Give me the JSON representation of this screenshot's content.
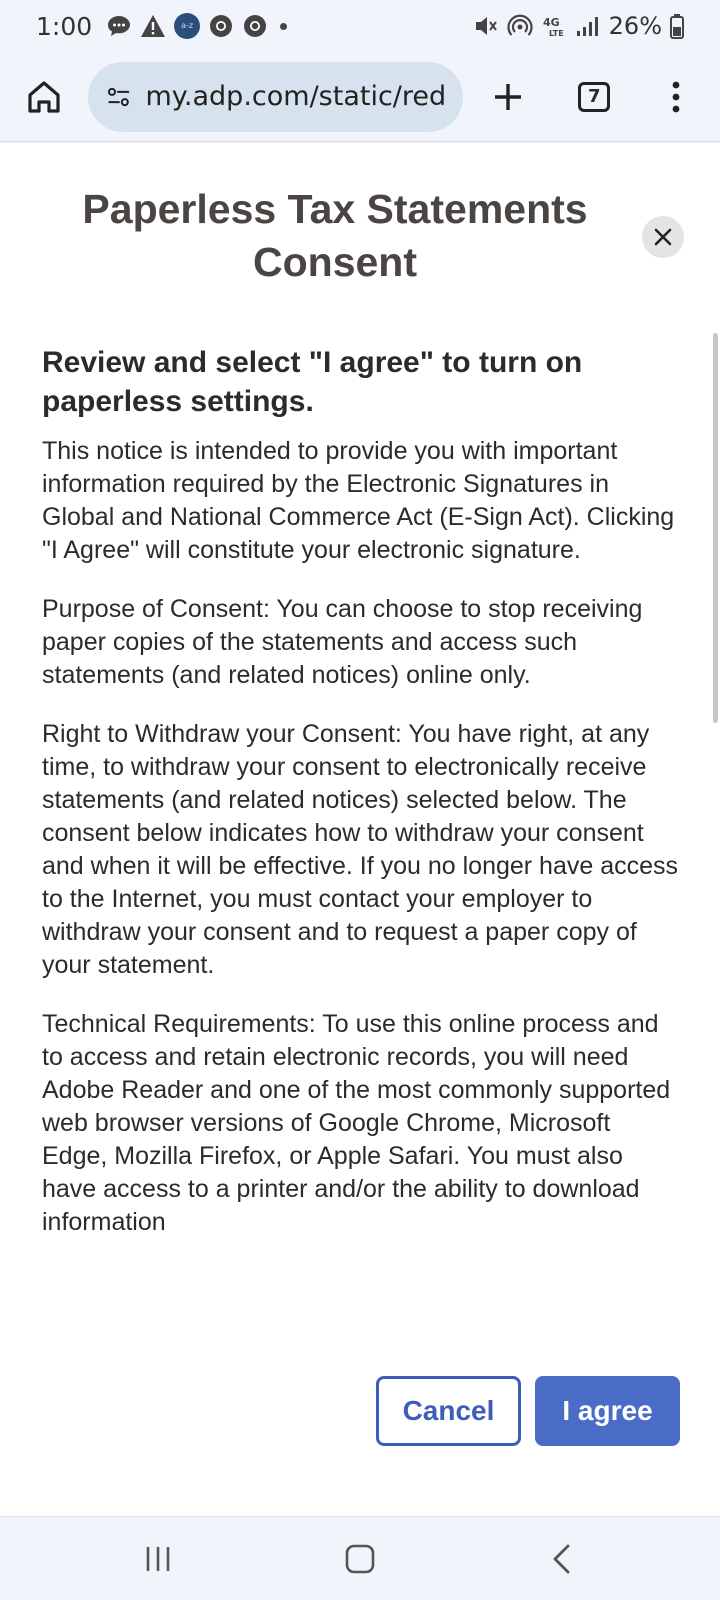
{
  "status_bar": {
    "time": "1:00",
    "battery": "26%",
    "icons": [
      "message-icon",
      "warning-icon",
      "amazon-a-to-z-icon",
      "chrome-icon",
      "chrome-icon",
      "dot-icon",
      "mute-icon",
      "hotspot-icon",
      "4g-lte-icon",
      "signal-icon",
      "battery-icon"
    ],
    "amazon_label": "a-z"
  },
  "browser": {
    "url": "my.adp.com/static/redbox",
    "tab_count": "7"
  },
  "modal": {
    "title": "Paperless Tax Statements Consent",
    "heading": "Review and select \"I agree\" to turn on paperless settings.",
    "paragraphs": [
      "This notice is intended to provide you with important information required by the Electronic Signatures in Global and National Commerce Act (E-Sign Act). Clicking \"I Agree\" will constitute your electronic signature.",
      "Purpose of Consent: You can choose to stop receiving paper copies of the statements and access such statements (and related notices) online only.",
      "Right to Withdraw your Consent: You have right, at any time, to withdraw your consent to electronically receive statements (and related notices) selected below. The consent below indicates how to withdraw your consent and when it will be effective. If you no longer have access to the Internet, you must contact your employer to withdraw your consent and to request a paper copy of your statement.",
      "Technical Requirements: To use this online process and to access and retain electronic records, you will need Adobe Reader and one of the most commonly supported web browser versions of Google Chrome, Microsoft Edge, Mozilla Firefox, or Apple Safari. You must also have access to a printer and/or the ability to download information"
    ],
    "cancel_label": "Cancel",
    "agree_label": "I agree"
  },
  "colors": {
    "primary": "#4a6cc7",
    "primary_outline": "#3d5db8",
    "url_bar": "#d6e2ed"
  }
}
